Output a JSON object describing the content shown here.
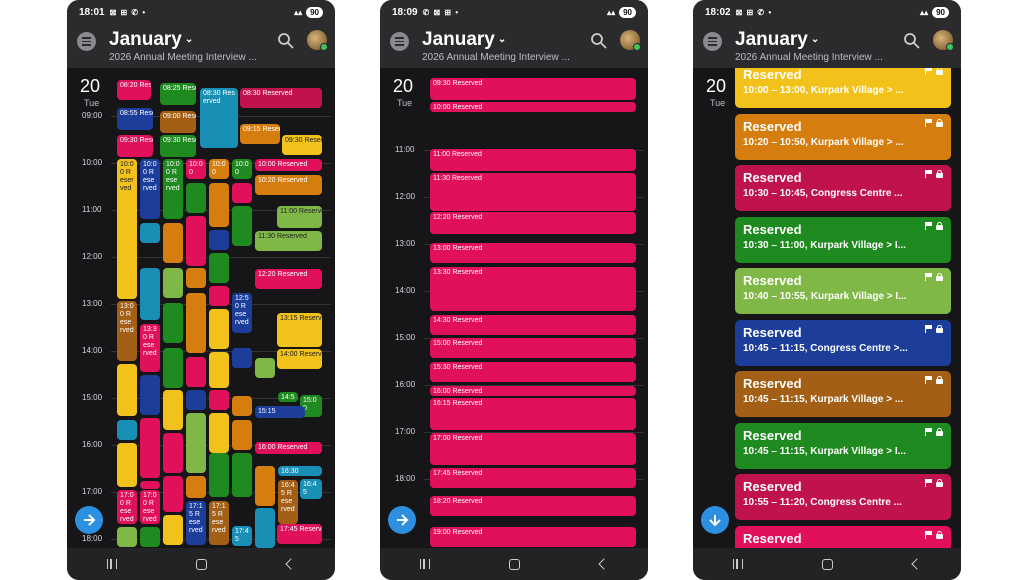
{
  "colors": {
    "pink": "#e0105a",
    "green": "#1f8a1f",
    "yellow": "#f2c21b",
    "orange": "#d67d10",
    "blue": "#1c3d9a",
    "teal": "#1a8fb5",
    "lime": "#7fb847",
    "brown": "#a35f16",
    "magenta": "#c0134e"
  },
  "header": {
    "month": "January",
    "subtitle": "2026 Annual Meeting Interview ...",
    "day_num": "20",
    "day_wd": "Tue"
  },
  "phone1": {
    "status": {
      "time": "18:01",
      "icons": "⊠ ⊞ ✆ •",
      "battery": "90"
    },
    "hours": [
      "09:00",
      "10:00",
      "11:00",
      "12:00",
      "13:00",
      "14:00",
      "15:00",
      "16:00",
      "17:00",
      "18:00"
    ],
    "events": [
      {
        "t": "08:20 Reserved",
        "c": "pink"
      },
      {
        "t": "08:25 Reserved",
        "c": "green"
      },
      {
        "t": "08:30 Reserved",
        "c": "teal"
      },
      {
        "t": "08:30 Reserved",
        "c": "magenta"
      },
      {
        "t": "08:55 Reserved",
        "c": "blue"
      },
      {
        "t": "09:00 Reserved",
        "c": "brown"
      },
      {
        "t": "09:15 Reserved",
        "c": "orange"
      },
      {
        "t": "09:30 Reserved",
        "c": "pink"
      },
      {
        "t": "09:30 Reserved",
        "c": "green"
      },
      {
        "t": "09:30 Reserved",
        "c": "yellow"
      },
      {
        "t": "10:00 Reserved",
        "c": "yellow"
      },
      {
        "t": "10:0 0 Rese rved",
        "c": "blue"
      },
      {
        "t": "10:0 0 Rese rved",
        "c": "green"
      },
      {
        "t": "10:0 0",
        "c": "pink"
      },
      {
        "t": "10:0 0",
        "c": "orange"
      },
      {
        "t": "10:0 0",
        "c": "green"
      },
      {
        "t": "10:00 Reserved",
        "c": "pink"
      },
      {
        "t": "10:20 Reserved",
        "c": "orange"
      },
      {
        "t": "11:00 Reserved",
        "c": "lime"
      },
      {
        "t": "11:30 Reserved",
        "c": "lime"
      },
      {
        "t": "12:20 Reserved",
        "c": "pink"
      },
      {
        "t": "13:15 Reserved",
        "c": "yellow"
      },
      {
        "t": "14:00 Reserved",
        "c": "yellow"
      },
      {
        "t": "13:0 0 Rese rved",
        "c": "brown"
      },
      {
        "t": "13:3 0 Rese rved",
        "c": "pink"
      },
      {
        "t": "12:5 0 Rese rved",
        "c": "blue"
      },
      {
        "t": "14:5",
        "c": "green"
      },
      {
        "t": "15:00",
        "c": "green"
      },
      {
        "t": "15:15",
        "c": "blue"
      },
      {
        "t": "16:00 Reserved",
        "c": "pink"
      },
      {
        "t": "16:30",
        "c": "teal"
      },
      {
        "t": "16:4 5",
        "c": "teal"
      },
      {
        "t": "16:4 5 Rese rved",
        "c": "brown"
      },
      {
        "t": "17:45 Reserved",
        "c": "pink"
      },
      {
        "t": "17:1 5 Rese rved",
        "c": "brown"
      },
      {
        "t": "17:1 5 Rese rved",
        "c": "blue"
      },
      {
        "t": "17:0 0 Rese rved",
        "c": "pink"
      },
      {
        "t": "17:0 0 Rese rved",
        "c": "pink"
      },
      {
        "t": "17:4 5",
        "c": "teal"
      }
    ]
  },
  "phone2": {
    "status": {
      "time": "18:09",
      "icons": "✆ ⊠ ⊞ •",
      "battery": "90"
    },
    "hours": [
      "11:00",
      "12:00",
      "13:00",
      "14:00",
      "15:00",
      "16:00",
      "17:00",
      "18:00"
    ],
    "events": [
      "09:30 Reserved",
      "10:00 Reserved",
      "11:00 Reserved",
      "11:30 Reserved",
      "12:20 Reserved",
      "13:00 Reserved",
      "13:30 Reserved",
      "14:30 Reserved",
      "15:00 Reserved",
      "15:30 Reserved",
      "16:00 Reserved",
      "16:15 Reserved",
      "17:00 Reserved",
      "17:45 Reserved",
      "18:20 Reserved",
      "19:00 Reserved"
    ]
  },
  "phone3": {
    "status": {
      "time": "18:02",
      "icons": "⊠ ⊞ ✆ •",
      "battery": "90"
    },
    "cards": [
      {
        "title": "Reserved",
        "sub": "10:00 – 13:00, Kurpark Village > ...",
        "c": "yellow"
      },
      {
        "title": "Reserved",
        "sub": "10:20 – 10:50, Kurpark Village > ...",
        "c": "orange"
      },
      {
        "title": "Reserved",
        "sub": "10:30 – 10:45, Congress Centre ...",
        "c": "magenta"
      },
      {
        "title": "Reserved",
        "sub": "10:30 – 11:00, Kurpark Village > I...",
        "c": "green"
      },
      {
        "title": "Reserved",
        "sub": "10:40 – 10:55, Kurpark Village > I...",
        "c": "lime"
      },
      {
        "title": "Reserved",
        "sub": "10:45 – 11:15, Congress Centre >...",
        "c": "blue"
      },
      {
        "title": "Reserved",
        "sub": "10:45 – 11:15, Kurpark Village > ...",
        "c": "brown"
      },
      {
        "title": "Reserved",
        "sub": "10:45 – 11:15, Kurpark Village > I...",
        "c": "green"
      },
      {
        "title": "Reserved",
        "sub": "10:55 – 11:20, Congress Centre ...",
        "c": "magenta"
      },
      {
        "title": "Reserved",
        "sub": "",
        "c": "pink"
      }
    ]
  }
}
